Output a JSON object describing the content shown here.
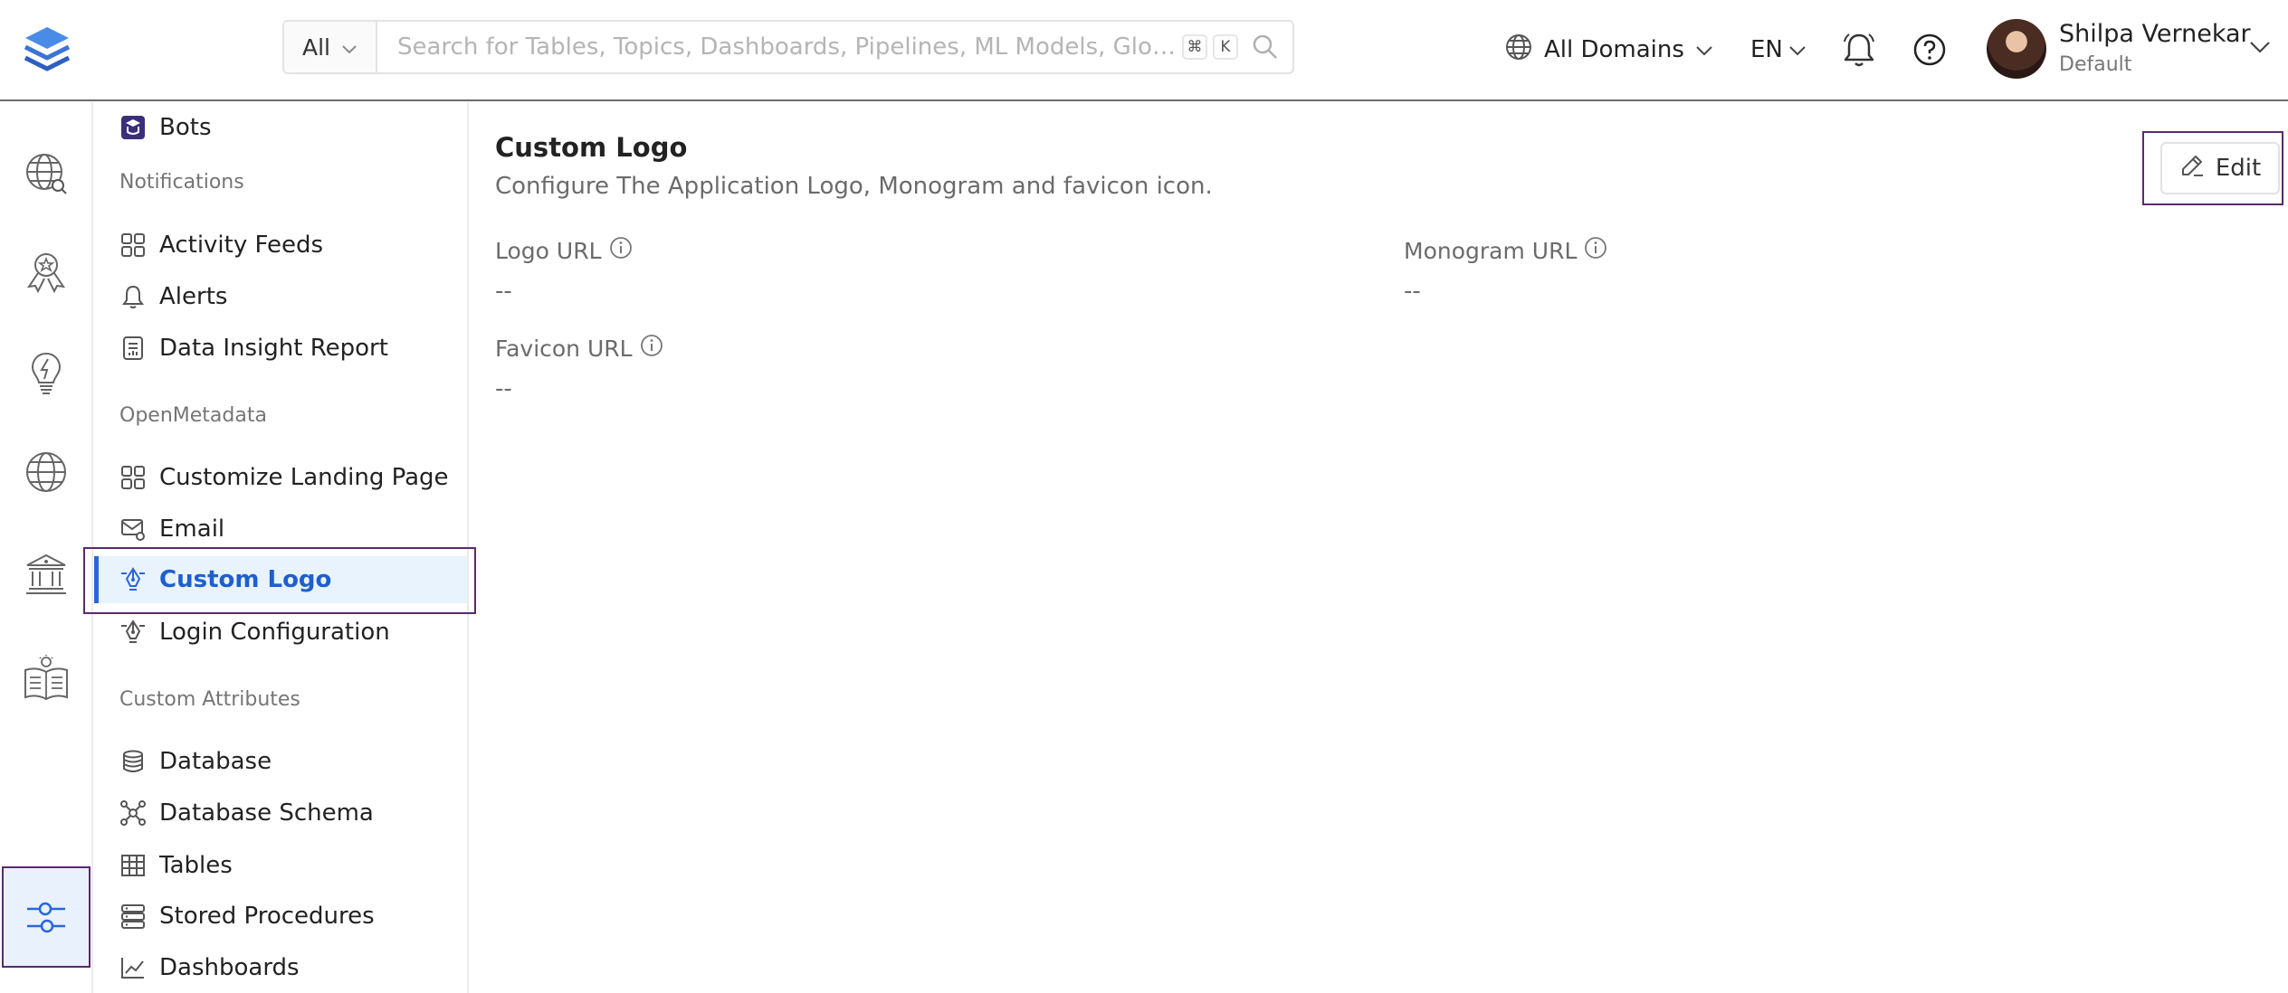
{
  "header": {
    "search_scope": "All",
    "search_placeholder": "Search for Tables, Topics, Dashboards, Pipelines, ML Models, Gloss...",
    "shortcut_cmd": "⌘",
    "shortcut_key": "K",
    "domains_label": "All Domains",
    "language": "EN",
    "user_name": "Shilpa Vernekar",
    "user_role": "Default"
  },
  "rail": {
    "icons": [
      "explore-icon",
      "data-quality-icon",
      "insights-icon",
      "domains-icon",
      "governance-icon",
      "glossary-book-icon",
      "settings-icon"
    ]
  },
  "menu": {
    "bots": "Bots",
    "section_notifications": "Notifications",
    "activity_feeds": "Activity Feeds",
    "alerts": "Alerts",
    "data_insight_report": "Data Insight Report",
    "section_openmetadata": "OpenMetadata",
    "customize_landing_page": "Customize Landing Page",
    "email": "Email",
    "custom_logo": "Custom Logo",
    "login_configuration": "Login Configuration",
    "section_custom_attributes": "Custom Attributes",
    "database": "Database",
    "database_schema": "Database Schema",
    "tables": "Tables",
    "stored_procedures": "Stored Procedures",
    "dashboards": "Dashboards"
  },
  "main": {
    "title": "Custom Logo",
    "description": "Configure The Application Logo, Monogram and favicon icon.",
    "edit_label": "Edit",
    "logo_url_label": "Logo URL",
    "logo_url_value": "--",
    "monogram_url_label": "Monogram URL",
    "monogram_url_value": "--",
    "favicon_url_label": "Favicon URL",
    "favicon_url_value": "--"
  },
  "colors": {
    "accent": "#2a66d9",
    "selected_bg": "#e8f3fd",
    "highlight_border": "#5a2a6e"
  }
}
